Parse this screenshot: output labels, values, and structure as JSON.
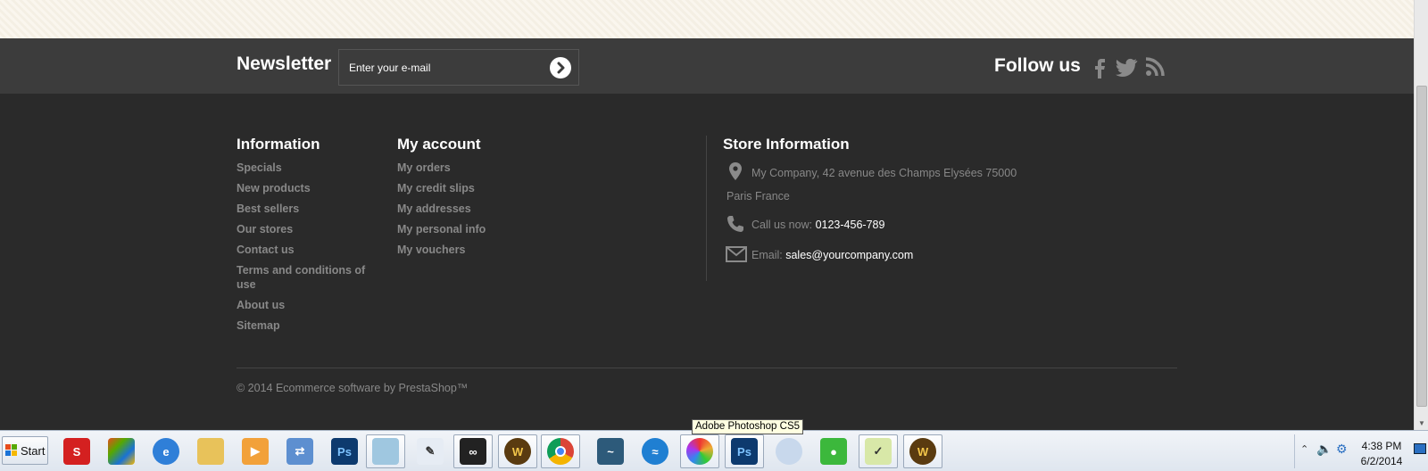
{
  "newsletter": {
    "title": "Newsletter",
    "email_placeholder": "Enter your e-mail"
  },
  "follow": {
    "title": "Follow us",
    "icons": [
      "facebook-icon",
      "twitter-icon",
      "rss-icon"
    ]
  },
  "information": {
    "title": "Information",
    "links": [
      "Specials",
      "New products",
      "Best sellers",
      "Our stores",
      "Contact us",
      "Terms and conditions of use",
      "About us",
      "Sitemap"
    ]
  },
  "my_account": {
    "title": "My account",
    "links": [
      "My orders",
      "My credit slips",
      "My addresses",
      "My personal info",
      "My vouchers"
    ]
  },
  "store_info": {
    "title": "Store Information",
    "address_line1": "My Company, 42 avenue des Champs Elysées 75000",
    "address_line2": "Paris France",
    "phone_label": "Call us now:",
    "phone": "0123-456-789",
    "email_label": "Email:",
    "email": "sales@yourcompany.com"
  },
  "copyright": "© 2014 Ecommerce software by PrestaShop™",
  "taskbar": {
    "start_label": "Start",
    "tooltip": "Adobe Photoshop CS5",
    "clock_time": "4:38 PM",
    "clock_date": "6/2/2014",
    "ps_label": "Ps",
    "apps": [
      "adobe-icon",
      "windows-live-icon",
      "internet-explorer-icon",
      "file-explorer-icon",
      "media-player-icon",
      "transfer-icon",
      "photoshop-icon",
      "notepad-icon",
      "pen-icon",
      "binoculars-icon",
      "warcraft-icon",
      "chrome-icon",
      "mysql-icon",
      "filezilla-icon",
      "color-picker-icon",
      "photoshop-active-icon",
      "disc-icon",
      "vpn-icon",
      "editor-icon",
      "warcraft-2-icon"
    ]
  },
  "colors": {
    "footer_bg": "#2a2a2a",
    "newsletter_bg": "#3c3c3c",
    "link_gray": "#888888",
    "text_white": "#ffffff"
  }
}
